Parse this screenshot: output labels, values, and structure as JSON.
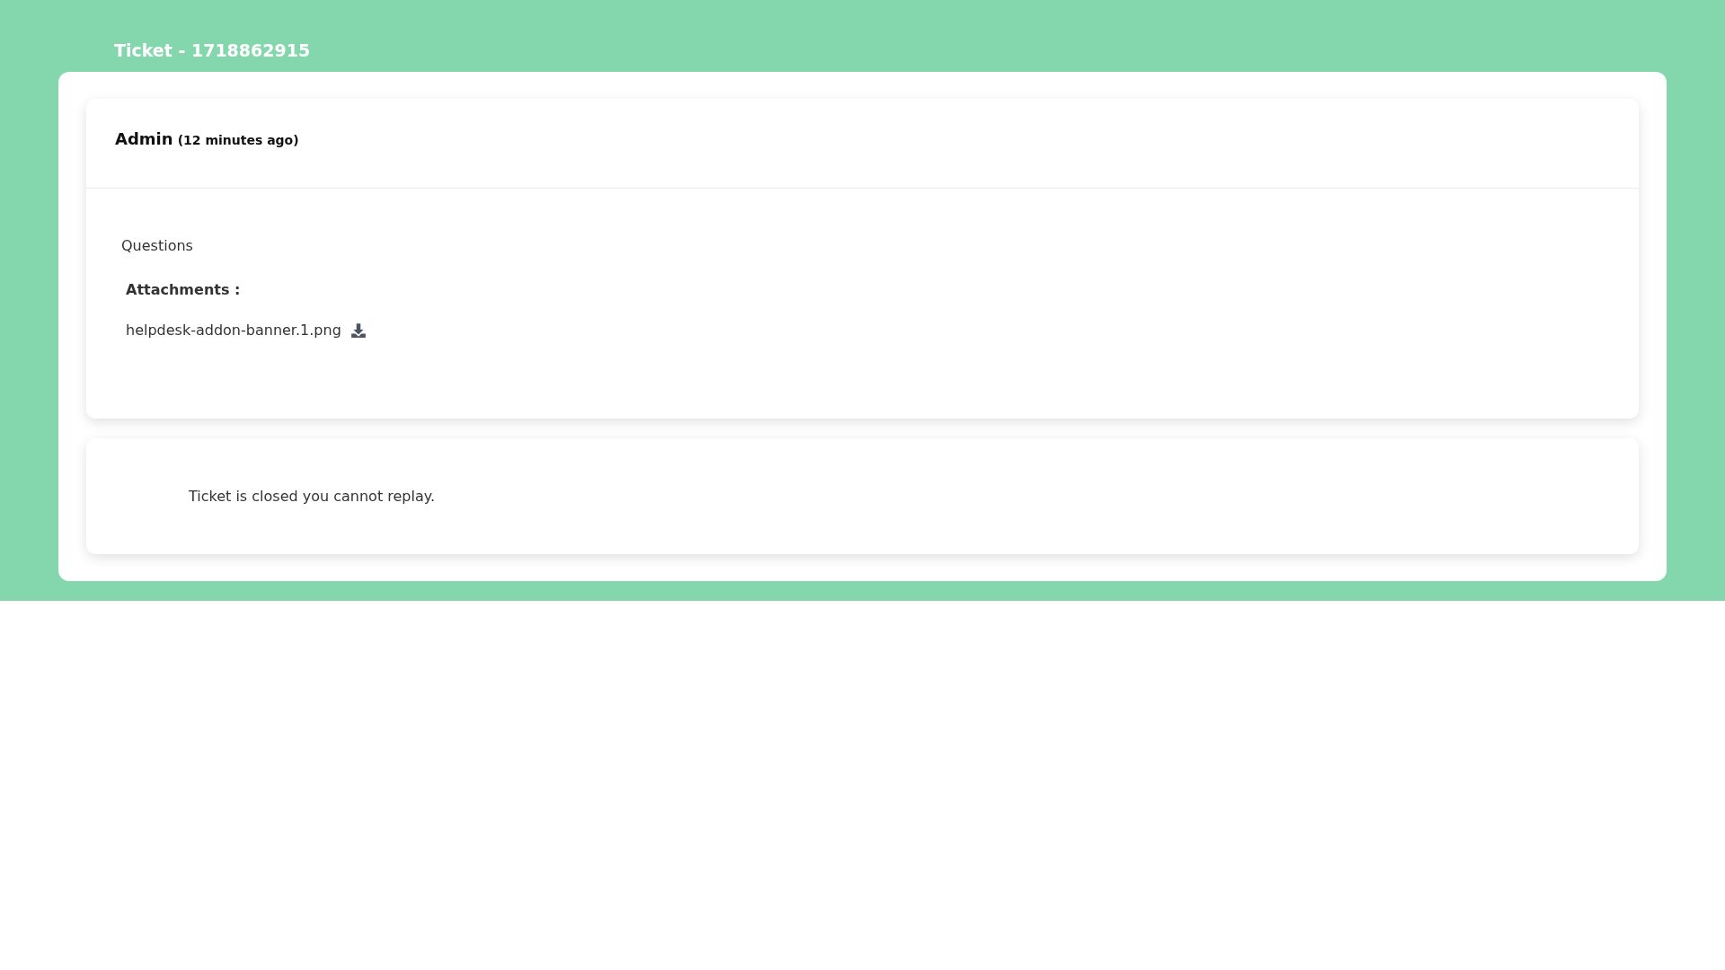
{
  "page_title": "Ticket - 1718862915",
  "message": {
    "author": "Admin",
    "time": "(12 minutes ago)",
    "body": "Questions",
    "attachments_label": "Attachments :",
    "attachments": [
      {
        "file_name": "helpdesk-addon-banner.1.png"
      }
    ]
  },
  "notice": "Ticket is closed you cannot replay."
}
